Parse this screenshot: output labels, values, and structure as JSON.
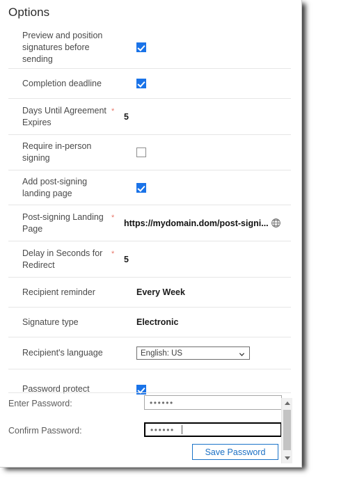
{
  "panel": {
    "title": "Options"
  },
  "rows": [
    {
      "label": "Preview and position signatures before sending",
      "required": false,
      "type": "checkbox",
      "value": "checked"
    },
    {
      "label": "Completion deadline",
      "required": false,
      "type": "checkbox",
      "value": "checked"
    },
    {
      "label": "Days Until Agreement Expires",
      "required": true,
      "type": "text",
      "value": "5"
    },
    {
      "label": "Require in-person signing",
      "required": false,
      "type": "checkbox",
      "value": "unchecked"
    },
    {
      "label": "Add post-signing landing page",
      "required": false,
      "type": "checkbox",
      "value": "checked"
    },
    {
      "label": "Post-signing Landing Page",
      "required": true,
      "type": "url",
      "value": "https://mydomain.dom/post-signi...",
      "icon": "globe-icon"
    },
    {
      "label": "Delay in Seconds for Redirect",
      "required": true,
      "type": "text",
      "value": "5"
    },
    {
      "label": "Recipient reminder",
      "required": false,
      "type": "text",
      "value": "Every Week"
    },
    {
      "label": "Signature type",
      "required": false,
      "type": "text",
      "value": "Electronic"
    },
    {
      "label": "Recipient's language",
      "required": false,
      "type": "select",
      "value": "English: US"
    },
    {
      "label": "Password protect",
      "required": false,
      "type": "checkbox",
      "value": "checked"
    }
  ],
  "required_marker": "*",
  "password": {
    "enter_label": "Enter Password:",
    "enter_value": "••••••",
    "confirm_label": "Confirm Password:",
    "confirm_value": "••••••",
    "save_label": "Save Password"
  },
  "colors": {
    "checkbox_accent": "#1a73e8",
    "required_star": "#e8776a",
    "button_blue": "#1a6fc4",
    "label_gray": "#4a4a4a"
  }
}
